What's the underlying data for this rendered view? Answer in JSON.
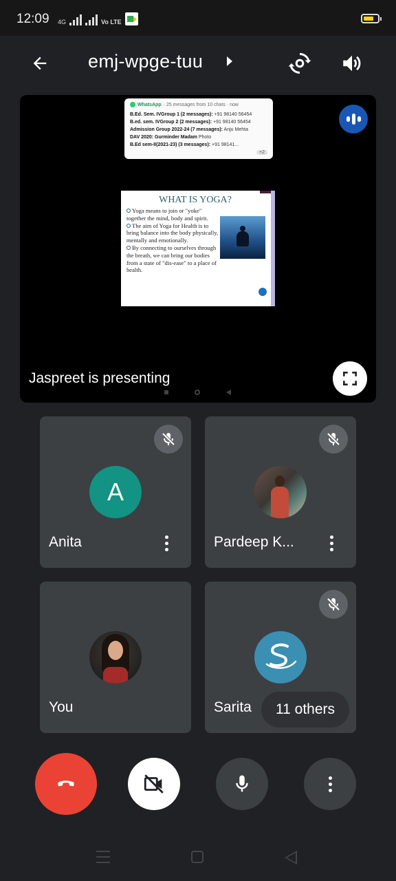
{
  "status_bar": {
    "time": "12:09",
    "network": "4G",
    "volte": "Vo LTE",
    "battery_color": "#ffd60a"
  },
  "top_bar": {
    "meeting_code": "emj-wpge-tuu",
    "back_icon": "arrow-left-icon",
    "switch_camera_icon": "switch-camera-icon",
    "speaker_icon": "speaker-icon"
  },
  "presentation": {
    "presenting_text": "Jaspreet is presenting",
    "notification": {
      "app": "WhatsApp",
      "summary": "· 25 messages from 10 chats · now",
      "lines": [
        {
          "bold": "B.Ed. Sem. IVGroup 1 (2 messages):",
          "text": " +91 98140 56454"
        },
        {
          "bold": "B.ed. sem. IVGroup 2 (2 messages):",
          "text": " +91 98140 56454"
        },
        {
          "bold": "Admission Group 2022-24 (7 messages):",
          "text": " Anju Mehta"
        },
        {
          "bold": "DAV 2020: Gurminder Madam",
          "text": " Photo"
        },
        {
          "bold": "B.Ed sem-II(2021-23) (3 messages):",
          "text": " +91 98141..."
        }
      ],
      "more_count": "+2"
    },
    "slide": {
      "title": "WHAT IS YOGA?",
      "bullets": [
        "Yoga means to join or \"yoke\" together the mind, body and spirit.",
        "The aim of Yoga for Health is to bring balance into the body physically, mentally and emotionally.",
        "By connecting to ourselves through the breath, we can bring our bodies from a state of \"dis-ease\" to a place of health."
      ]
    }
  },
  "participants": [
    {
      "name": "Anita",
      "avatar_letter": "A",
      "avatar_color": "#129383",
      "muted": true
    },
    {
      "name": "Pardeep K...",
      "muted": true
    },
    {
      "name": "You",
      "muted": false
    },
    {
      "name": "Sarita",
      "muted": true
    }
  ],
  "others_label": "11 others",
  "controls": {
    "end_call_color": "#ea4335",
    "end_call_icon": "end-call-icon",
    "camera_icon": "camera-off-icon",
    "mic_icon": "mic-icon",
    "more_icon": "more-vert-icon"
  }
}
